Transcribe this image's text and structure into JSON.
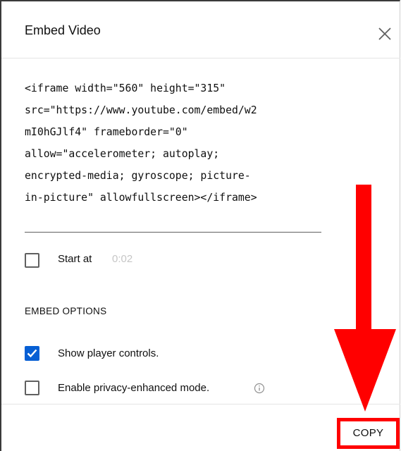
{
  "dialog": {
    "title": "Embed Video",
    "close_icon": "close-icon"
  },
  "embed_code": {
    "lines": [
      "<iframe width=\"560\" height=\"315\"",
      "src=\"https://www.youtube.com/embed/w2",
      "mI0hGJlf4\" frameborder=\"0\"",
      "allow=\"accelerometer; autoplay;",
      "encrypted-media; gyroscope; picture-",
      "in-picture\" allowfullscreen></iframe>"
    ]
  },
  "start_at": {
    "label": "Start at",
    "time": "0:02",
    "checked": false
  },
  "embed_options": {
    "heading": "EMBED OPTIONS",
    "show_controls": {
      "label": "Show player controls.",
      "checked": true
    },
    "privacy_mode": {
      "label": "Enable privacy-enhanced mode.",
      "checked": false,
      "info_icon": "info-icon"
    }
  },
  "footer": {
    "copy_label": "COPY"
  },
  "annotation": {
    "arrow_icon": "arrow-down-icon",
    "highlight_color": "#ff0000"
  },
  "colors": {
    "accent": "#065fd4",
    "text": "#0f0f0f",
    "muted": "#c6c6c6"
  }
}
